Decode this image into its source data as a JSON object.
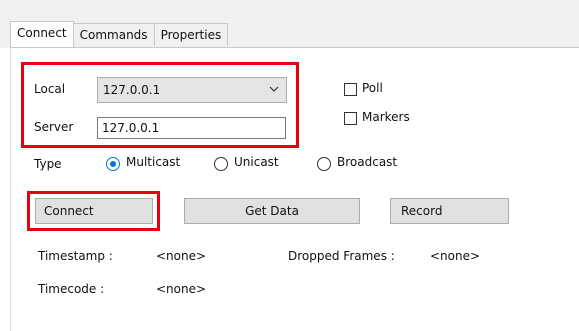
{
  "tabs": [
    {
      "label": "Connect",
      "active": true
    },
    {
      "label": "Commands",
      "active": false
    },
    {
      "label": "Properties",
      "active": false
    }
  ],
  "connect": {
    "local_label": "Local",
    "local_value": "127.0.0.1",
    "server_label": "Server",
    "server_value": "127.0.0.1",
    "poll_label": "Poll",
    "poll_checked": false,
    "markers_label": "Markers",
    "markers_checked": false,
    "type_label": "Type",
    "type_options": [
      {
        "label": "Multicast",
        "selected": true
      },
      {
        "label": "Unicast",
        "selected": false
      },
      {
        "label": "Broadcast",
        "selected": false
      }
    ],
    "connect_label": "Connect",
    "get_data_label": "Get Data",
    "record_label": "Record",
    "timestamp_label": "Timestamp :",
    "timestamp_value": "<none>",
    "dropped_label": "Dropped Frames :",
    "dropped_value": "<none>",
    "timecode_label": "Timecode :",
    "timecode_value": "<none>"
  },
  "colors": {
    "highlight": "#e60012",
    "radio_accent": "#0078d7"
  }
}
